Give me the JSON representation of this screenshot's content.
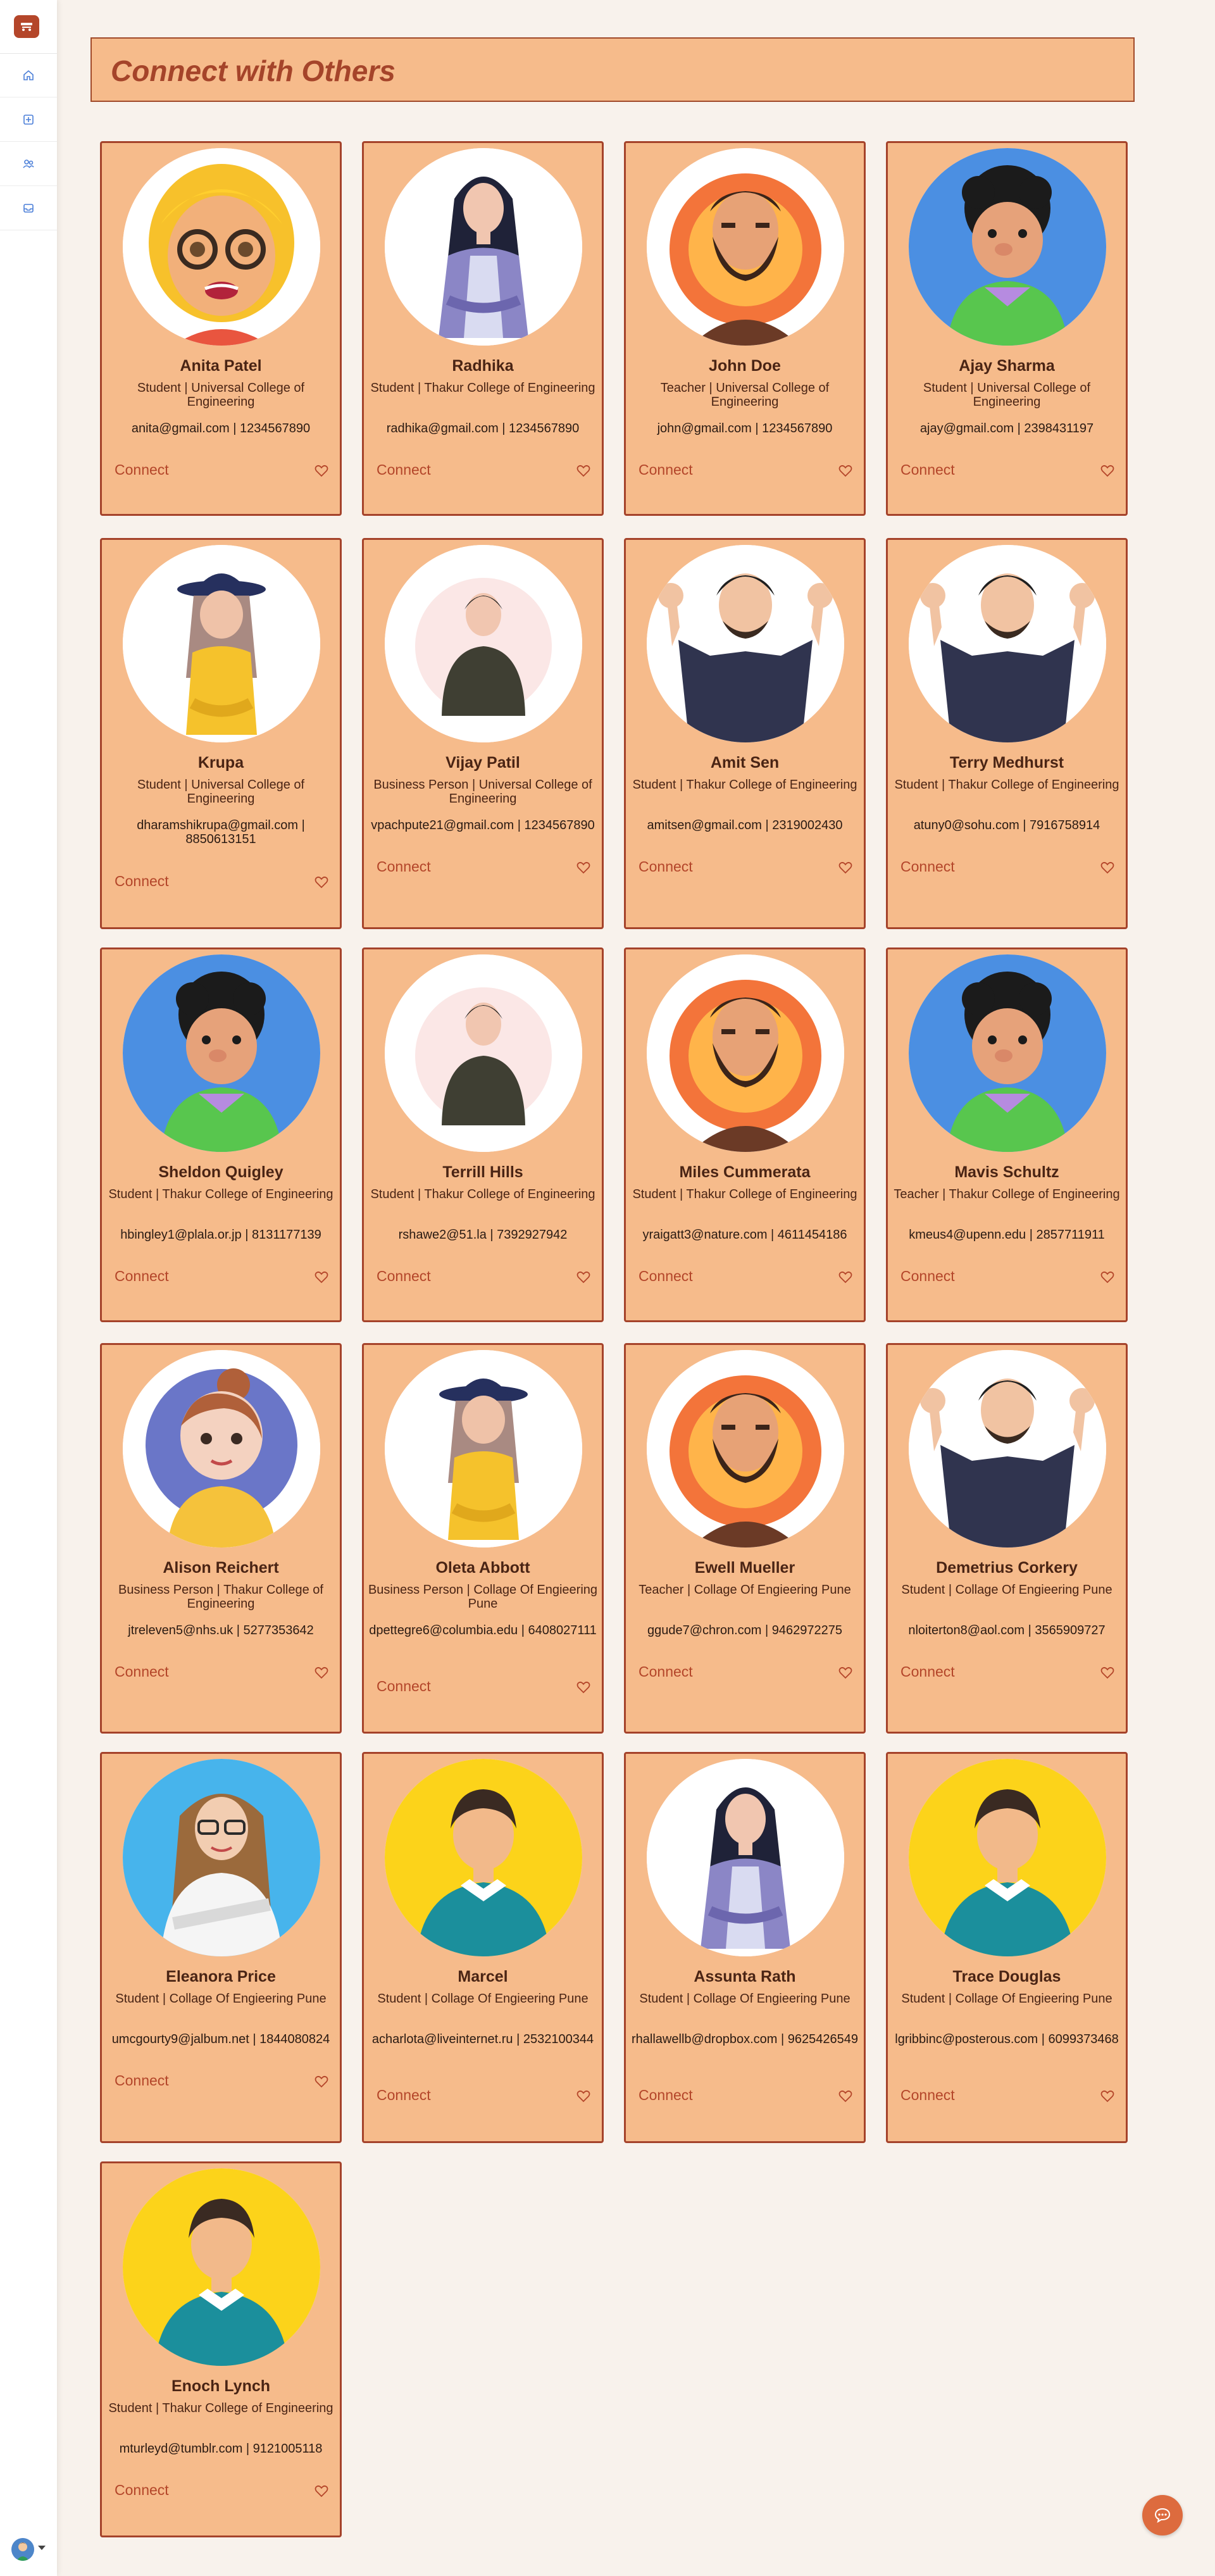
{
  "page": {
    "title": "Connect with Others"
  },
  "sidebar": {
    "items": [
      {
        "icon": "home-icon"
      },
      {
        "icon": "add-square-icon"
      },
      {
        "icon": "users-icon"
      },
      {
        "icon": "inbox-icon"
      }
    ]
  },
  "card_labels": {
    "connect": "Connect"
  },
  "people": [
    {
      "name": "Anita Patel",
      "role": "Student | Universal College of Engineering",
      "contact": "anita@gmail.com | 1234567890",
      "avatar": "yellow-hair-glasses"
    },
    {
      "name": "Radhika",
      "role": "Student | Thakur College of Engineering",
      "contact": "radhika@gmail.com | 1234567890",
      "avatar": "woman-purple"
    },
    {
      "name": "John Doe",
      "role": "Teacher | Universal College of Engineering",
      "contact": "john@gmail.com | 1234567890",
      "avatar": "beard-fire"
    },
    {
      "name": "Ajay Sharma",
      "role": "Student | Universal College of Engineering",
      "contact": "ajay@gmail.com | 2398431197",
      "avatar": "curly-blue"
    },
    {
      "name": "Krupa",
      "role": "Student | Universal College of Engineering",
      "contact": "dharamshikrupa@gmail.com | 8850613151",
      "avatar": "hat-yellow"
    },
    {
      "name": "Vijay Patil",
      "role": "Business Person | Universal College of Engineering",
      "contact": "vpachpute21@gmail.com | 1234567890",
      "avatar": "plain-man"
    },
    {
      "name": "Amit Sen",
      "role": "Student | Thakur College of Engineering",
      "contact": "amitsen@gmail.com | 2319002430",
      "avatar": "waving-man"
    },
    {
      "name": "Terry Medhurst",
      "role": "Student | Thakur College of Engineering",
      "contact": "atuny0@sohu.com | 7916758914",
      "avatar": "waving-man"
    },
    {
      "name": "Sheldon Quigley",
      "role": "Student | Thakur College of Engineering",
      "contact": "hbingley1@plala.or.jp | 8131177139",
      "avatar": "curly-blue"
    },
    {
      "name": "Terrill Hills",
      "role": "Student | Thakur College of Engineering",
      "contact": "rshawe2@51.la | 7392927942",
      "avatar": "plain-man"
    },
    {
      "name": "Miles Cummerata",
      "role": "Student | Thakur College of Engineering",
      "contact": "yraigatt3@nature.com | 4611454186",
      "avatar": "beard-fire"
    },
    {
      "name": "Mavis Schultz",
      "role": "Teacher | Thakur College of Engineering",
      "contact": "kmeus4@upenn.edu | 2857711911",
      "avatar": "curly-blue"
    },
    {
      "name": "Alison Reichert",
      "role": "Business Person | Thakur College of Engineering",
      "contact": "jtreleven5@nhs.uk | 5277353642",
      "avatar": "bun-girl"
    },
    {
      "name": "Oleta Abbott",
      "role": "Business Person | Collage Of Engieering Pune",
      "contact": "dpettegre6@columbia.edu | 6408027111",
      "avatar": "hat-yellow"
    },
    {
      "name": "Ewell Mueller",
      "role": "Teacher | Collage Of Engieering Pune",
      "contact": "ggude7@chron.com | 9462972275",
      "avatar": "beard-fire"
    },
    {
      "name": "Demetrius Corkery",
      "role": "Student | Collage Of Engieering Pune",
      "contact": "nloiterton8@aol.com | 3565909727",
      "avatar": "waving-man"
    },
    {
      "name": "Eleanora Price",
      "role": "Student | Collage Of Engieering Pune",
      "contact": "umcgourty9@jalbum.net | 1844080824",
      "avatar": "glasses-woman"
    },
    {
      "name": "Marcel",
      "role": "Student | Collage Of Engieering Pune",
      "contact": "acharlota@liveinternet.ru | 2532100344",
      "avatar": "yellow-bg-man"
    },
    {
      "name": "Assunta Rath",
      "role": "Student | Collage Of Engieering Pune",
      "contact": "rhallawellb@dropbox.com | 9625426549",
      "avatar": "woman-purple"
    },
    {
      "name": "Trace Douglas",
      "role": "Student | Collage Of Engieering Pune",
      "contact": "lgribbinc@posterous.com | 6099373468",
      "avatar": "yellow-bg-man"
    },
    {
      "name": "Enoch Lynch",
      "role": "Student | Thakur College of Engineering",
      "contact": "mturleyd@tumblr.com | 9121005118",
      "avatar": "yellow-bg-man"
    }
  ],
  "colors": {
    "background": "#f8f2ec",
    "card": "#f6bb8b",
    "card_border": "#a5432b",
    "accent": "#b4462a",
    "chat_button": "#dd6b3e"
  }
}
